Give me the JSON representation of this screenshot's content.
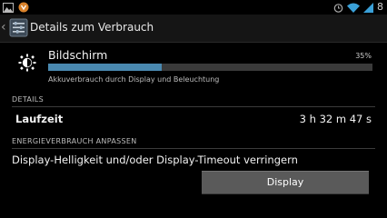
{
  "status_bar": {
    "icons_left": [
      "picture-icon",
      "notification-icon"
    ],
    "icons_right": [
      "alarm-icon",
      "wifi-icon",
      "signal-icon"
    ],
    "time": "8"
  },
  "action_bar": {
    "title": "Details zum Verbrauch"
  },
  "usage_item": {
    "title": "Bildschirm",
    "percent_label": "35%",
    "percent_value": 35,
    "description": "Akkuverbrauch durch Display und Beleuchtung",
    "bar_color": "#4a89b0"
  },
  "details": {
    "header": "DETAILS",
    "duration_label": "Laufzeit",
    "duration_value": "3 h 32 m 47 s"
  },
  "adjust": {
    "header": "ENERGIEVERBRAUCH ANPASSEN",
    "text": "Display-Helligkeit und/oder Display-Timeout verringern",
    "button_label": "Display"
  }
}
